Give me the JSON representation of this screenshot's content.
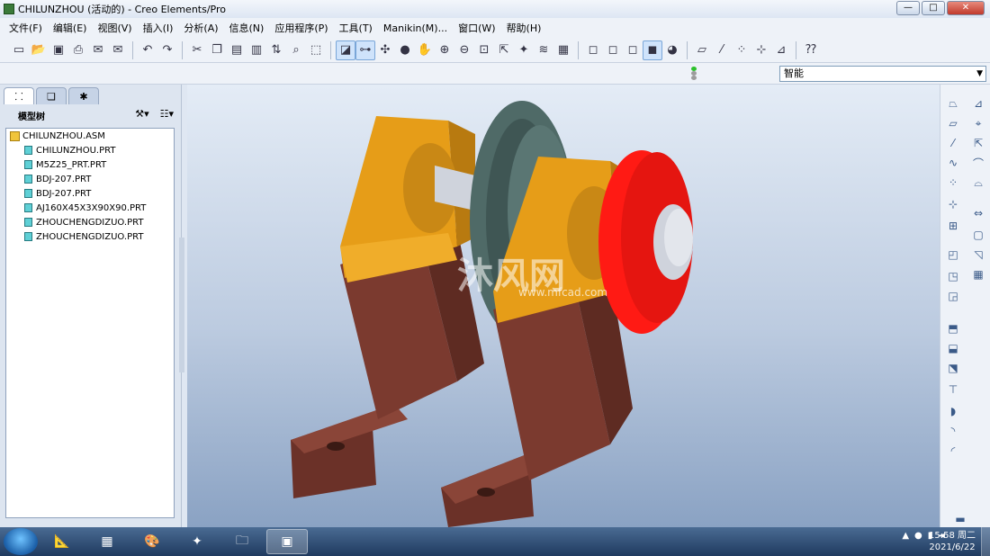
{
  "window": {
    "title": "CHILUNZHOU (活动的) - Creo Elements/Pro",
    "minimize": "—",
    "maximize": "□",
    "close": "✕"
  },
  "menu": [
    "文件(F)",
    "编辑(E)",
    "视图(V)",
    "插入(I)",
    "分析(A)",
    "信息(N)",
    "应用程序(P)",
    "工具(T)",
    "Manikin(M)...",
    "窗口(W)",
    "帮助(H)"
  ],
  "toolbar": {
    "icons": [
      "new-icon",
      "open-icon",
      "save-icon",
      "print-icon",
      "email-icon",
      "email2-icon",
      "undo-icon",
      "redo-icon",
      "cut-icon",
      "copy-icon",
      "paste-icon",
      "paste-special-icon",
      "regenerate-icon",
      "find-icon",
      "select-box-icon",
      "datum-display-icon",
      "orient-icon",
      "saved-views-icon",
      "appearance-icon",
      "pan-icon",
      "zoom-in-icon",
      "zoom-out-icon",
      "refit-icon",
      "reorient-icon",
      "spin-center-icon",
      "layers-icon",
      "view-manager-icon",
      "wireframe-icon",
      "hidden-line-icon",
      "no-hidden-icon",
      "shading-icon",
      "enhanced-realism-icon",
      "datum-planes-icon",
      "datum-axes-icon",
      "datum-points-icon",
      "coord-sys-icon",
      "help-icon"
    ]
  },
  "filter": {
    "value": "智能"
  },
  "left_panel": {
    "header": "模型树",
    "tabs": [
      "tree-tab",
      "layers-tab",
      "favorites-tab"
    ],
    "tree": {
      "root": "CHILUNZHOU.ASM",
      "children": [
        "CHILUNZHOU.PRT",
        "M5Z25_PRT.PRT",
        "BDJ-207.PRT",
        "BDJ-207.PRT",
        "AJ160X45X3X90X90.PRT",
        "ZHOUCHENGDIZUO.PRT",
        "ZHOUCHENGDIZUO.PRT"
      ]
    }
  },
  "viewport": {
    "watermark": "沐风网",
    "watermark_url": "www.mfcad.com",
    "colors": {
      "bracket": "#e69d18",
      "base": "#7b3a2f",
      "pulley": "#4f6a67",
      "gear": "#ff1a14",
      "shaft": "#cfd3dc"
    }
  },
  "taskbar": {
    "clock_time": "15:58 周二",
    "clock_date": "2021/6/22"
  }
}
